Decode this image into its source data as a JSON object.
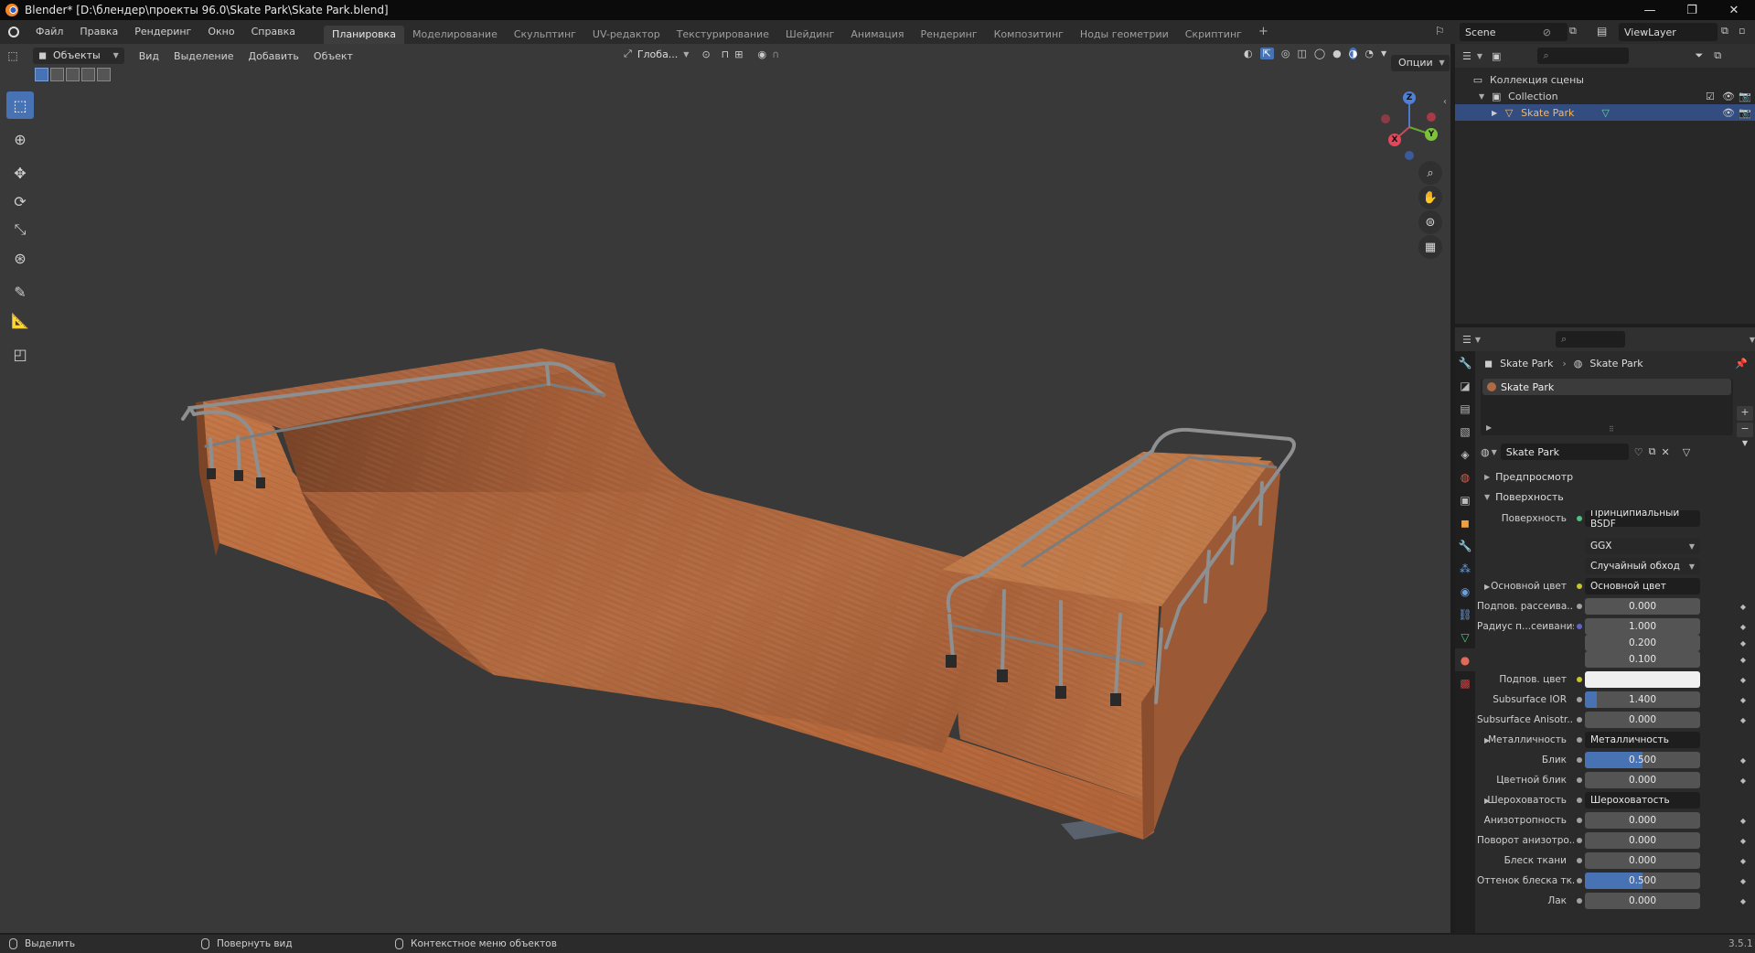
{
  "window": {
    "title": "Blender* [D:\\блендер\\проекты 96.0\\Skate Park\\Skate Park.blend]",
    "minimize": "—",
    "restore": "❐",
    "close": "✕"
  },
  "menu": [
    "Файл",
    "Правка",
    "Рендеринг",
    "Окно",
    "Справка"
  ],
  "workspaces": {
    "tabs": [
      "Планировка",
      "Моделирование",
      "Скульптинг",
      "UV-редактор",
      "Текстурирование",
      "Шейдинг",
      "Анимация",
      "Рендеринг",
      "Композитинг",
      "Ноды геометрии",
      "Скриптинг"
    ],
    "active": "Планировка",
    "add": "+"
  },
  "scene": {
    "scene_name": "Scene",
    "view_layer": "ViewLayer"
  },
  "viewport": {
    "mode": "Объекты",
    "header_menus": [
      "Вид",
      "Выделение",
      "Добавить",
      "Объект"
    ],
    "transform_orientation": "Глоба...",
    "options_label": "Опции",
    "gizmo_axes": {
      "x": "X",
      "y": "Y",
      "z": "Z"
    }
  },
  "outliner": {
    "search_placeholder": "",
    "scene_collection": "Коллекция сцены",
    "collection": "Collection",
    "object": "Skate Park"
  },
  "properties": {
    "search_placeholder": "",
    "breadcrumb": [
      "Skate Park",
      "Skate Park"
    ],
    "slot_name": "Skate Park",
    "material_name": "Skate Park",
    "sections": {
      "preview": "Предпросмотр",
      "surface": "Поверхность"
    },
    "surface": {
      "surface_label": "Поверхность",
      "shader": "Принципиальный BSDF",
      "distribution": "GGX",
      "subsurface_method": "Случайный обход",
      "rows": [
        {
          "label": "Основной цвет",
          "type": "link",
          "value": "Основной цвет",
          "socket": "#c7c729",
          "expand": true
        },
        {
          "label": "Подпов. рассеива...",
          "type": "num",
          "value": "0.000",
          "socket": "#a1a1a1"
        },
        {
          "label": "Радиус п...сеивания",
          "type": "num",
          "value": "1.000",
          "socket": "#6363c7"
        },
        {
          "label": "",
          "type": "num",
          "value": "0.200"
        },
        {
          "label": "",
          "type": "num",
          "value": "0.100"
        },
        {
          "label": "Подпов. цвет",
          "type": "color",
          "value": "",
          "socket": "#c7c729"
        },
        {
          "label": "Subsurface IOR",
          "type": "num",
          "value": "1.400",
          "socket": "#a1a1a1",
          "fill": 0.1
        },
        {
          "label": "Subsurface Anisotr...",
          "type": "num",
          "value": "0.000",
          "socket": "#a1a1a1"
        },
        {
          "label": "Металличность",
          "type": "link",
          "value": "Металличность",
          "socket": "#a1a1a1",
          "expand": true
        },
        {
          "label": "Блик",
          "type": "num",
          "value": "0.500",
          "socket": "#a1a1a1",
          "fill": 0.5
        },
        {
          "label": "Цветной блик",
          "type": "num",
          "value": "0.000",
          "socket": "#a1a1a1"
        },
        {
          "label": "Шероховатость",
          "type": "link",
          "value": "Шероховатость",
          "socket": "#a1a1a1",
          "expand": true
        },
        {
          "label": "Анизотропность",
          "type": "num",
          "value": "0.000",
          "socket": "#a1a1a1"
        },
        {
          "label": "Поворот анизотро...",
          "type": "num",
          "value": "0.000",
          "socket": "#a1a1a1"
        },
        {
          "label": "Блеск ткани",
          "type": "num",
          "value": "0.000",
          "socket": "#a1a1a1"
        },
        {
          "label": "Оттенок блеска тк...",
          "type": "num",
          "value": "0.500",
          "socket": "#a1a1a1",
          "fill": 0.5
        },
        {
          "label": "Лак",
          "type": "num",
          "value": "0.000",
          "socket": "#a1a1a1"
        }
      ]
    }
  },
  "statusbar": {
    "select": "Выделить",
    "rotate": "Повернуть вид",
    "context": "Контекстное меню объектов",
    "version": "3.5.1"
  },
  "colors": {
    "accent": "#4772b3",
    "selected_row": "#334d80",
    "object_name": "#f0b96b",
    "wood": "#b8693c",
    "rail": "#8e8f90"
  }
}
